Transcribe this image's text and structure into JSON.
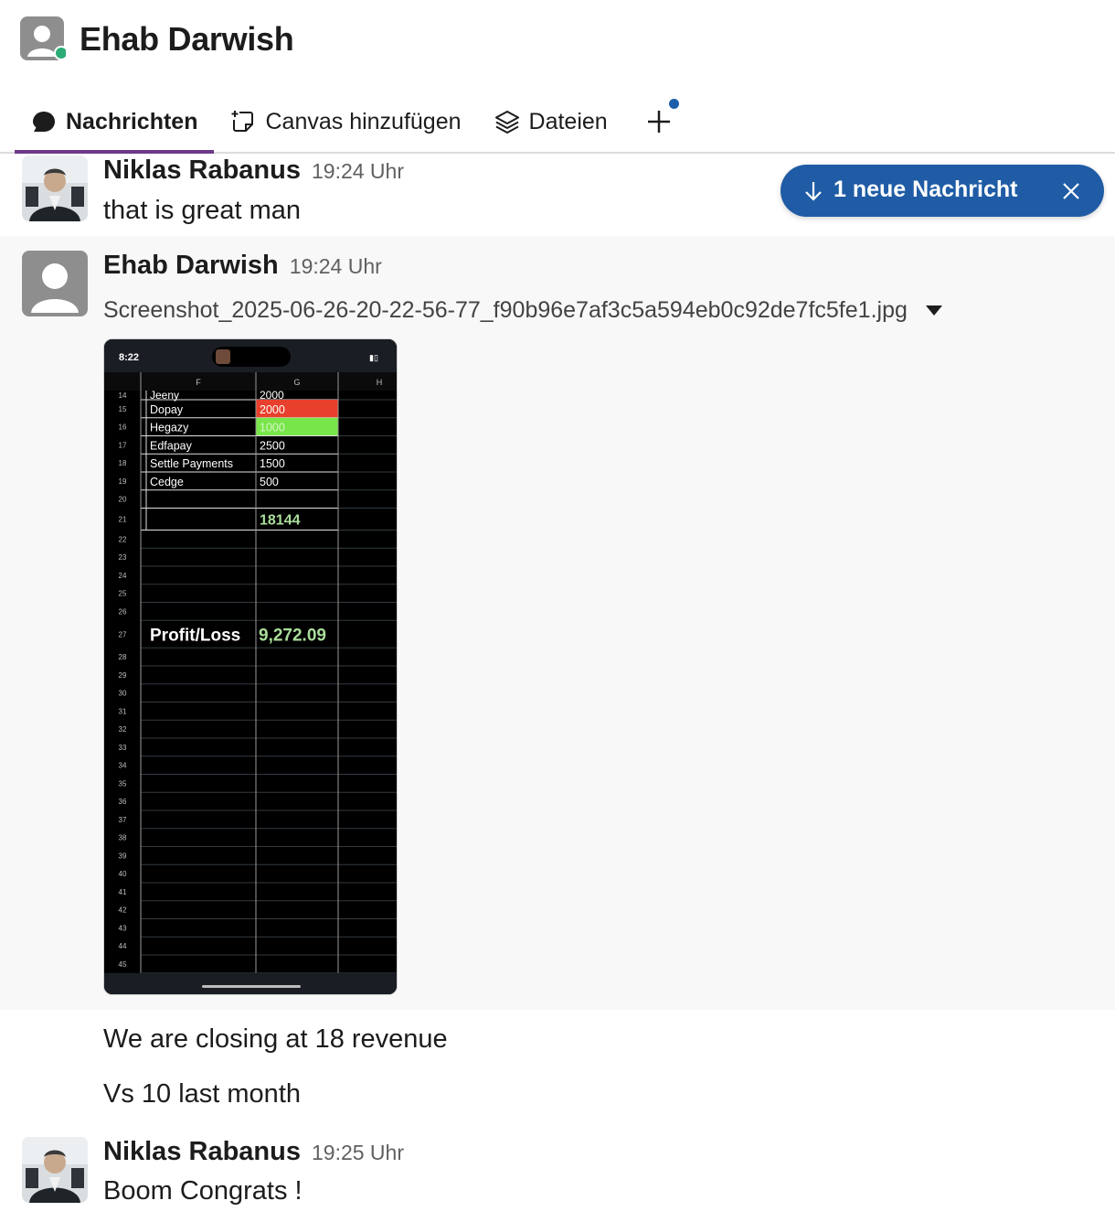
{
  "header": {
    "title": "Ehab Darwish",
    "presence_color": "#2bac76",
    "tabs": [
      {
        "label": "Nachrichten",
        "icon": "chat-bubble-icon",
        "active": true
      },
      {
        "label": "Canvas hinzufügen",
        "icon": "canvas-add-icon",
        "active": false
      },
      {
        "label": "Dateien",
        "icon": "layers-icon",
        "active": false
      }
    ],
    "add_tab_icon": "plus-icon"
  },
  "new_message_pill": {
    "label": "1 neue Nachricht",
    "icon": "arrow-down-icon",
    "close_icon": "close-icon",
    "color": "#1f5ca5"
  },
  "messages": [
    {
      "author": "Niklas Rabanus",
      "time": "19:24 Uhr",
      "text": "that is great man"
    },
    {
      "author": "Ehab Darwish",
      "time": "19:24 Uhr",
      "file": {
        "name": "Screenshot_2025-06-26-20-22-56-77_f90b96e7af3c5a594eb0c92de7fc5fe1.jpg",
        "caret_icon": "caret-down-icon",
        "preview": {
          "status_time": "8:22",
          "columns": [
            "F",
            "G",
            "H"
          ],
          "rows": [
            {
              "num": "14",
              "f": "Jeeny",
              "g": "2000"
            },
            {
              "num": "15",
              "f": "Dopay",
              "g": "2000",
              "g_color": "#e8402c"
            },
            {
              "num": "16",
              "f": "Hegazy",
              "g": "1000",
              "g_color": "#78e64a"
            },
            {
              "num": "17",
              "f": "Edfapay",
              "g": "2500"
            },
            {
              "num": "18",
              "f": "Settle Payments",
              "g": "1500"
            },
            {
              "num": "19",
              "f": "Cedge",
              "g": "500"
            },
            {
              "num": "20",
              "f": "",
              "g": ""
            },
            {
              "num": "21",
              "f": "",
              "g": "18144"
            }
          ],
          "blank_rows_a": [
            "22",
            "23",
            "24",
            "25",
            "26"
          ],
          "profit_row": {
            "num": "27",
            "label": "Profit/Loss",
            "value": "9,272.09"
          },
          "blank_rows_b": [
            "28",
            "29",
            "30",
            "31",
            "32",
            "33",
            "34",
            "35",
            "36",
            "37",
            "38",
            "39",
            "40",
            "41",
            "42",
            "43",
            "44",
            "45"
          ]
        }
      },
      "texts": [
        "We are closing at 18 revenue",
        "Vs 10 last month"
      ]
    },
    {
      "author": "Niklas Rabanus",
      "time": "19:25 Uhr",
      "text": "Boom Congrats !"
    }
  ]
}
